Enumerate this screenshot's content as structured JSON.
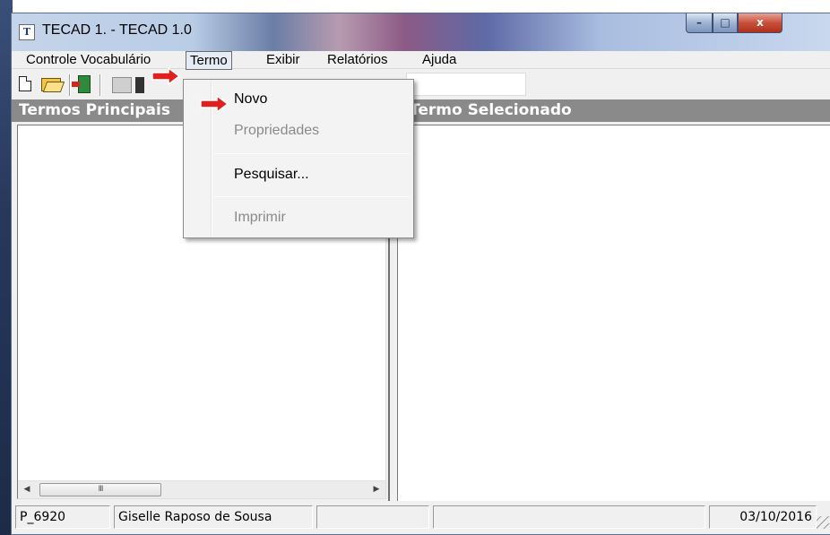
{
  "window": {
    "title": "TECAD 1. - TECAD 1.0",
    "app_icon_glyph": "T",
    "minimize_glyph": "–",
    "maximize_glyph": "□",
    "close_glyph": "x"
  },
  "menubar": {
    "items": [
      {
        "label": "Controle Vocabulário"
      },
      {
        "label": "Termo"
      },
      {
        "label": "Exibir"
      },
      {
        "label": "Relatórios"
      },
      {
        "label": "Ajuda"
      }
    ]
  },
  "toolbar": {
    "icons": [
      "new-document-icon",
      "open-folder-icon",
      "exit-door-icon",
      "print-icon",
      "find-icon"
    ]
  },
  "panels": {
    "left_header": "Termos Principais",
    "right_header": "Termo Selecionado"
  },
  "scrollbar": {
    "left_glyph": "◀",
    "right_glyph": "▶",
    "thumb_glyph": "III"
  },
  "dropdown": {
    "items": [
      {
        "label": "Novo",
        "enabled": true
      },
      {
        "label": "Propriedades",
        "enabled": false
      },
      {
        "label": "Pesquisar...",
        "enabled": true
      },
      {
        "label": "Imprimir",
        "enabled": false
      }
    ]
  },
  "statusbar": {
    "code": "P_6920",
    "user": "Giselle Raposo de Sousa",
    "date": "03/10/2016"
  },
  "colors": {
    "panel_header": "#8a8a8a",
    "annotation_arrow": "#e0201c",
    "disabled_text": "#8a8a8a"
  }
}
